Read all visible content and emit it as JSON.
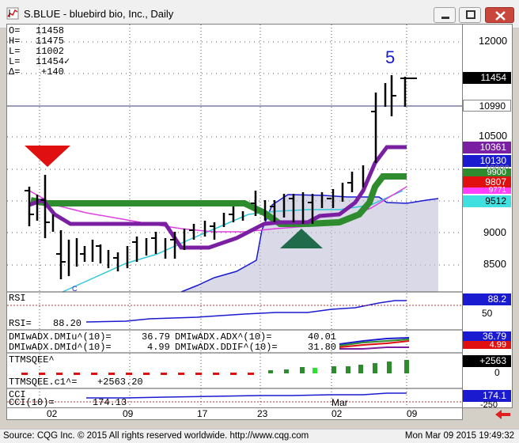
{
  "window": {
    "title": "S.BLUE - bluebird bio, Inc., Daily"
  },
  "ohlc": [
    {
      "key": "O=",
      "value": "11458"
    },
    {
      "key": "H=",
      "value": "11475"
    },
    {
      "key": "L=",
      "value": "11002"
    },
    {
      "key": "L=",
      "value": "11454✓"
    },
    {
      "key": "Δ=",
      "value": "+140"
    }
  ],
  "wave_label": "5",
  "c_label": "C",
  "price_axis": {
    "ticks": [
      "12000",
      "10500",
      "9000",
      "8500"
    ],
    "boxes": [
      {
        "value": "11454",
        "bg": "#000000",
        "fg": "#ffffff"
      },
      {
        "value": "10990",
        "bg": "#ffffff",
        "fg": "#000000"
      },
      {
        "value": "10361",
        "bg": "#7b1fa2",
        "fg": "#ffffff"
      },
      {
        "value": "10130",
        "bg": "#1a1ad0",
        "fg": "#ffffff"
      },
      {
        "value": "9900",
        "bg": "#2e8b2e",
        "fg": "#ffffff"
      },
      {
        "value": "9807",
        "bg": "#e01010",
        "fg": "#ffffff"
      },
      {
        "value": "9771",
        "bg": "#ff40ff",
        "fg": "#ffffff"
      },
      {
        "value": "9512",
        "bg": "#40e0e0",
        "fg": "#000000"
      }
    ],
    "hidden_tick": "10000"
  },
  "rsi": {
    "label": "RSI",
    "readout_label": "RSI=",
    "readout_value": "88.20",
    "axis_box": "88.2",
    "axis_tick": "50"
  },
  "dmi": {
    "line1_left": "DMIwADX.DMIu^(10)=",
    "line1_val": "36.79",
    "line1_mid": "DMIwADX.ADX^(10)=",
    "line1_mid_val": "40.01",
    "line2_left": "DMIwADX.DMId^(10)=",
    "line2_val": "4.99",
    "line2_mid": "DMIwADX.DDIF^(10)=",
    "line2_mid_val": "31.80",
    "axis_box": "36.79",
    "axis_box2": "4.99"
  },
  "ttm": {
    "label": "TTMSQEE^",
    "readout_label": "TTMSQEE.c1^=",
    "readout_value": "+2563.20",
    "axis_box": "+2563",
    "axis_tick": "0"
  },
  "cci": {
    "label": "CCI",
    "readout_label": "CCI(10)=",
    "readout_value": "174.13",
    "axis_box": "174.1",
    "axis_tick": "-250"
  },
  "dates": [
    "02",
    "09",
    "17",
    "23",
    "02",
    "09"
  ],
  "month_label": "Mar",
  "status": {
    "left": "Source: CQG Inc. © 2015 All rights reserved worldwide. http://www.cqg.com",
    "right": "Mon Mar 09 2015 19:49:32"
  },
  "colors": {
    "green_band": "#2e8b2e",
    "purple": "#7b1fa2",
    "magenta": "#e040e0",
    "cyan": "#30c8d8",
    "blue": "#1a1ad0",
    "red_marker": "#e01010",
    "dark_green_marker": "#1f6b4a"
  }
}
